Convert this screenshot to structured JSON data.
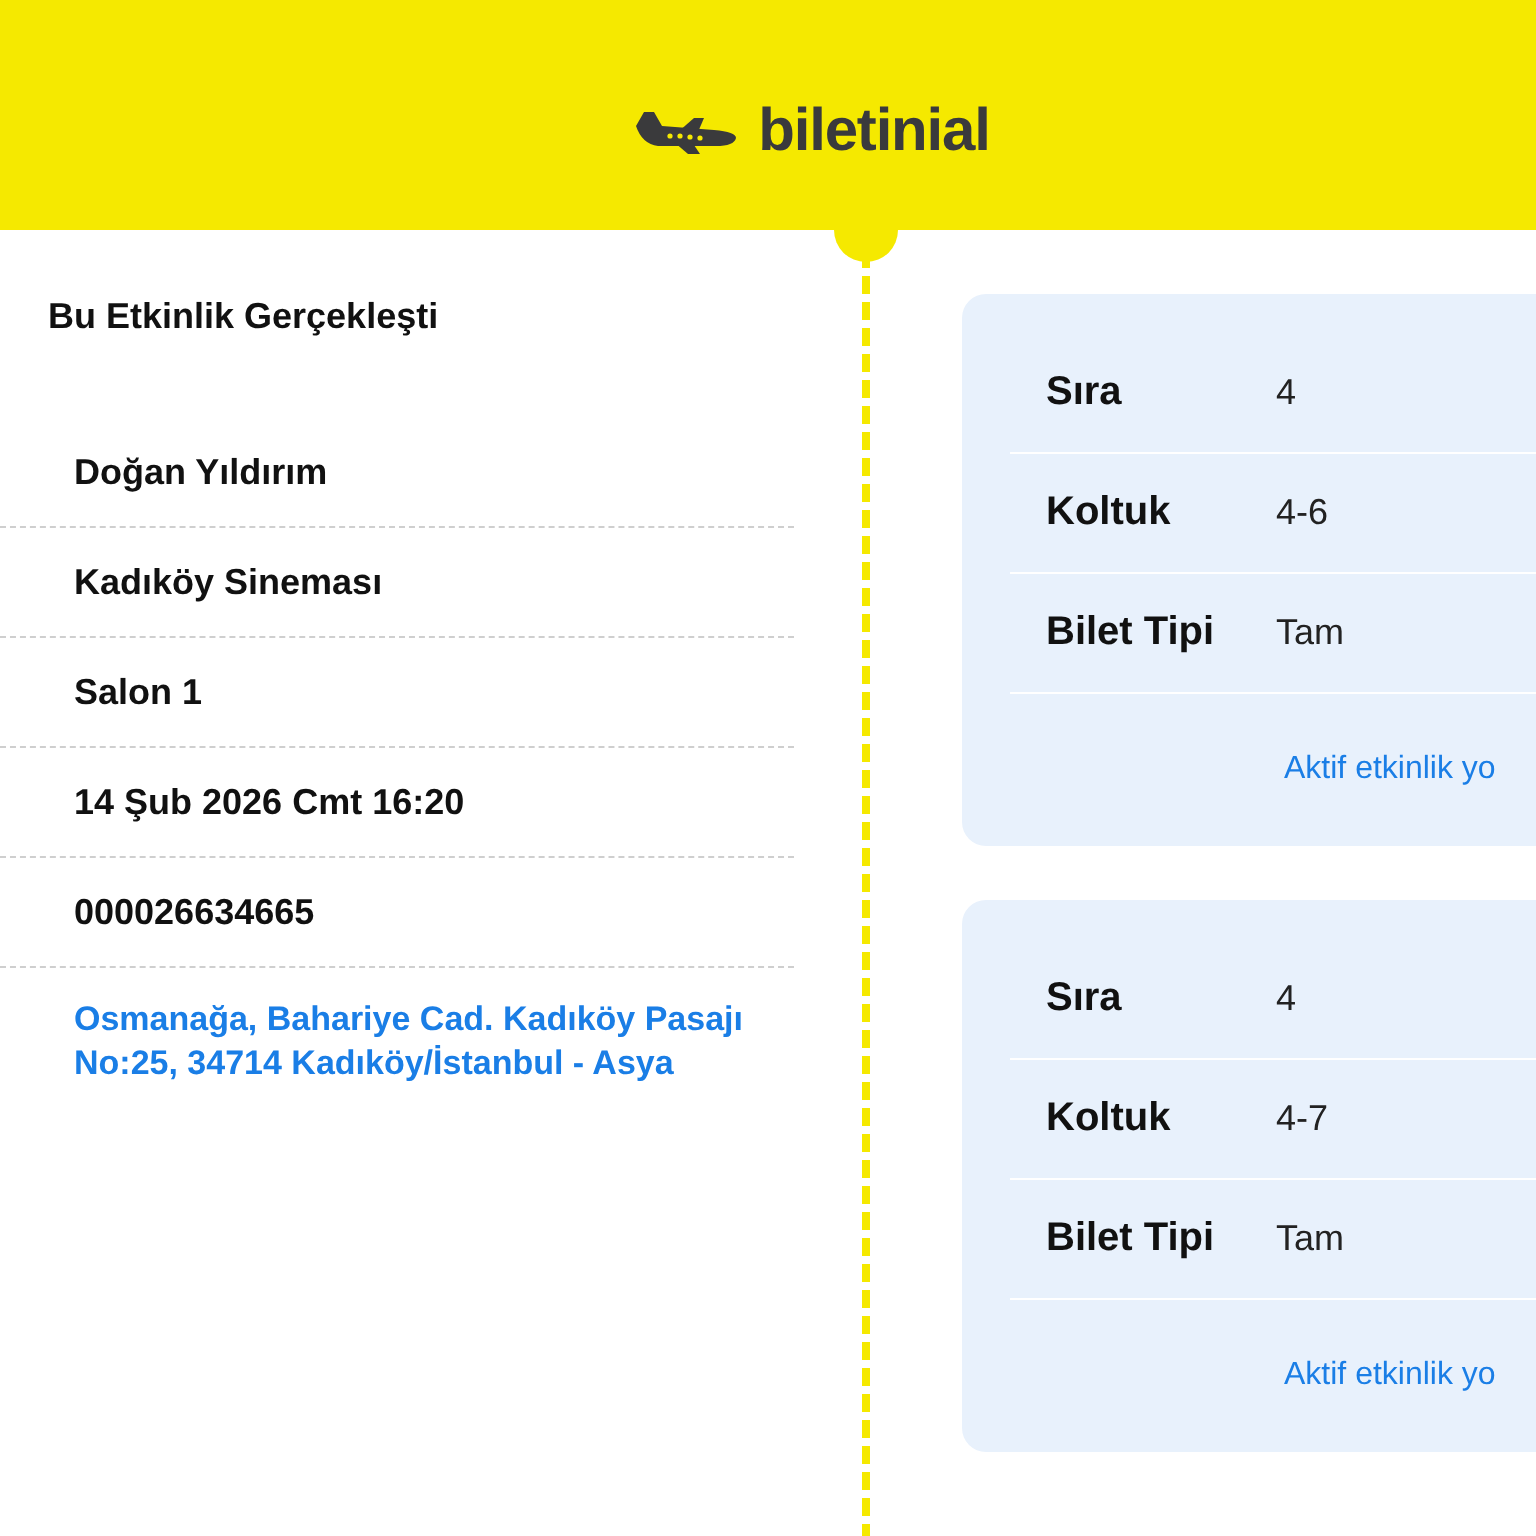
{
  "header": {
    "logo": "biletinial"
  },
  "event": {
    "status": "Bu Etkinlik Gerçekleşti",
    "details": [
      "Doğan Yıldırım",
      "Kadıköy Sineması",
      "Salon 1",
      "14 Şub 2026 Cmt 16:20",
      "000026634665"
    ],
    "address": "Osmanağa, Bahariye Cad. Kadıköy Pasajı No:25, 34714 Kadıköy/İstanbul - Asya"
  },
  "tickets": [
    {
      "rows": [
        {
          "label": "Sıra",
          "value": "4"
        },
        {
          "label": "Koltuk",
          "value": "4-6"
        },
        {
          "label": "Bilet Tipi",
          "value": "Tam"
        }
      ],
      "status_link": "Aktif etkinlik yo"
    },
    {
      "rows": [
        {
          "label": "Sıra",
          "value": "4"
        },
        {
          "label": "Koltuk",
          "value": "4-7"
        },
        {
          "label": "Bilet Tipi",
          "value": "Tam"
        }
      ],
      "status_link": "Aktif etkinlik yo"
    }
  ]
}
